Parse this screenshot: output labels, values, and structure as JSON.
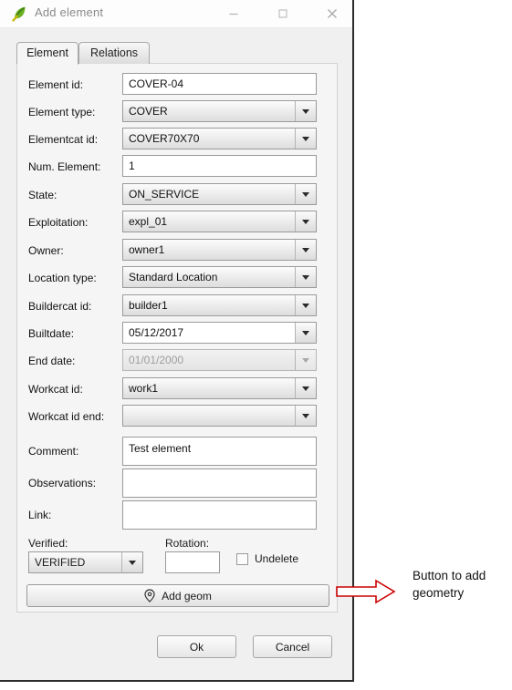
{
  "window": {
    "title": "Add element",
    "icon": "qgis-leaf-icon",
    "controls": {
      "minimize": "minimize-icon",
      "maximize": "maximize-icon",
      "close": "close-icon"
    }
  },
  "tabs": [
    {
      "label": "Element",
      "active": true
    },
    {
      "label": "Relations",
      "active": false
    }
  ],
  "form": {
    "fields": [
      {
        "label": "Element id:",
        "value": "COVER-04",
        "type": "text",
        "state": "enabled"
      },
      {
        "label": "Element type:",
        "value": "COVER",
        "type": "combo",
        "state": "enabled"
      },
      {
        "label": "Elementcat id:",
        "value": "COVER70X70",
        "type": "combo",
        "state": "enabled"
      },
      {
        "label": "Num. Element:",
        "value": "1",
        "type": "text",
        "state": "enabled"
      },
      {
        "label": "State:",
        "value": "ON_SERVICE",
        "type": "combo",
        "state": "enabled"
      },
      {
        "label": "Exploitation:",
        "value": "expl_01",
        "type": "combo",
        "state": "enabled"
      },
      {
        "label": "Owner:",
        "value": "owner1",
        "type": "combo",
        "state": "enabled"
      },
      {
        "label": "Location type:",
        "value": "Standard Location",
        "type": "combo",
        "state": "enabled"
      },
      {
        "label": "Buildercat id:",
        "value": "builder1",
        "type": "combo",
        "state": "enabled"
      },
      {
        "label": "Builtdate:",
        "value": "05/12/2017",
        "type": "combo-white",
        "state": "enabled"
      },
      {
        "label": "End date:",
        "value": "01/01/2000",
        "type": "combo",
        "state": "disabled"
      },
      {
        "label": "Workcat id:",
        "value": "work1",
        "type": "combo",
        "state": "enabled"
      },
      {
        "label": "Workcat id end:",
        "value": "",
        "type": "combo",
        "state": "enabled"
      },
      {
        "label": "Comment:",
        "value": "Test element",
        "type": "area",
        "state": "enabled"
      },
      {
        "label": "Observations:",
        "value": "",
        "type": "area",
        "state": "enabled"
      },
      {
        "label": "Link:",
        "value": "",
        "type": "area",
        "state": "enabled"
      }
    ],
    "verified": {
      "label": "Verified:",
      "value": "VERIFIED"
    },
    "rotation": {
      "label": "Rotation:",
      "value": ""
    },
    "undelete": {
      "label": "Undelete",
      "checked": false
    },
    "add_geom": {
      "label": "Add geom",
      "mnemonic": "g",
      "icon": "map-pin-icon"
    }
  },
  "footer": {
    "ok_label": "Ok",
    "cancel_label": "Cancel"
  },
  "annotation": {
    "text": "Button to add geometry",
    "color": "#cc0000",
    "icon": "right-arrow-callout"
  }
}
